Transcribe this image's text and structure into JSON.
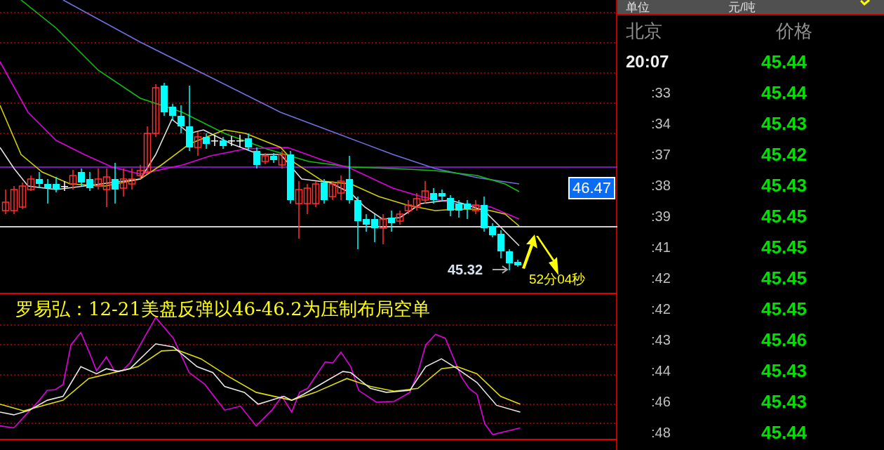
{
  "header": {
    "label": "单位",
    "unit": "元/吨"
  },
  "columns": {
    "time": "北京",
    "price": "价格"
  },
  "rows": [
    {
      "kind": "hour",
      "time": "20:07",
      "price": "45.44"
    },
    {
      "kind": "minute",
      "time": ":33",
      "price": "45.44"
    },
    {
      "kind": "minute",
      "time": ":34",
      "price": "45.43"
    },
    {
      "kind": "minute",
      "time": ":37",
      "price": "45.42"
    },
    {
      "kind": "minute",
      "time": ":38",
      "price": "45.43"
    },
    {
      "kind": "minute",
      "time": ":39",
      "price": "45.45"
    },
    {
      "kind": "minute",
      "time": ":41",
      "price": "45.45"
    },
    {
      "kind": "minute",
      "time": ":42",
      "price": "45.45"
    },
    {
      "kind": "minute",
      "time": ":42",
      "price": "45.45"
    },
    {
      "kind": "minute",
      "time": ":43",
      "price": "45.46"
    },
    {
      "kind": "minute",
      "time": ":44",
      "price": "45.43"
    },
    {
      "kind": "minute",
      "time": ":46",
      "price": "45.43"
    },
    {
      "kind": "minute",
      "time": ":48",
      "price": "45.44"
    }
  ],
  "chart": {
    "price_label": "46.47",
    "last_price": "45.32",
    "countdown": "52分04秒",
    "comment": "罗易弘：12-21美盘反弹以46-46.2为压制布局空单"
  }
}
